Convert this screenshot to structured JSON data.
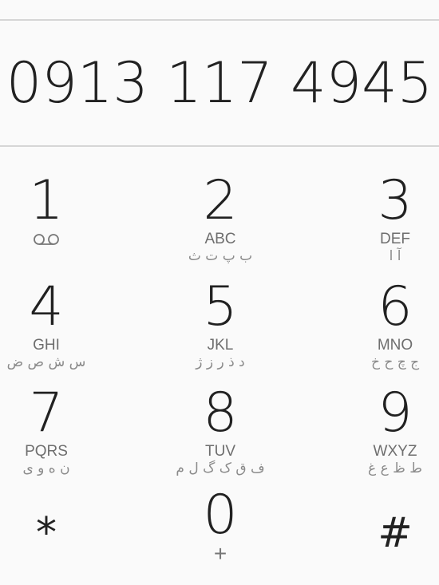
{
  "dialer": {
    "number": "0913 117 4945"
  },
  "keys": [
    {
      "digit": "1",
      "letters": "",
      "persian": "",
      "icon": "voicemail-icon"
    },
    {
      "digit": "2",
      "letters": "ABC",
      "persian": "ب پ ت ث"
    },
    {
      "digit": "3",
      "letters": "DEF",
      "persian": "آ ا"
    },
    {
      "digit": "4",
      "letters": "GHI",
      "persian": "س ش ص ض"
    },
    {
      "digit": "5",
      "letters": "JKL",
      "persian": "د ذ ر ز ژ"
    },
    {
      "digit": "6",
      "letters": "MNO",
      "persian": "ج چ ح خ"
    },
    {
      "digit": "7",
      "letters": "PQRS",
      "persian": "ن ه و ی"
    },
    {
      "digit": "8",
      "letters": "TUV",
      "persian": "ف ق ک گ ل م"
    },
    {
      "digit": "9",
      "letters": "WXYZ",
      "persian": "ط ظ ع غ"
    },
    {
      "digit": "*"
    },
    {
      "digit": "0",
      "sub": "+"
    },
    {
      "digit": "#"
    }
  ],
  "colors": {
    "background": "#fafafa",
    "divider": "#d6d6d6",
    "digit": "#212121",
    "letters": "#6e6e6e"
  }
}
